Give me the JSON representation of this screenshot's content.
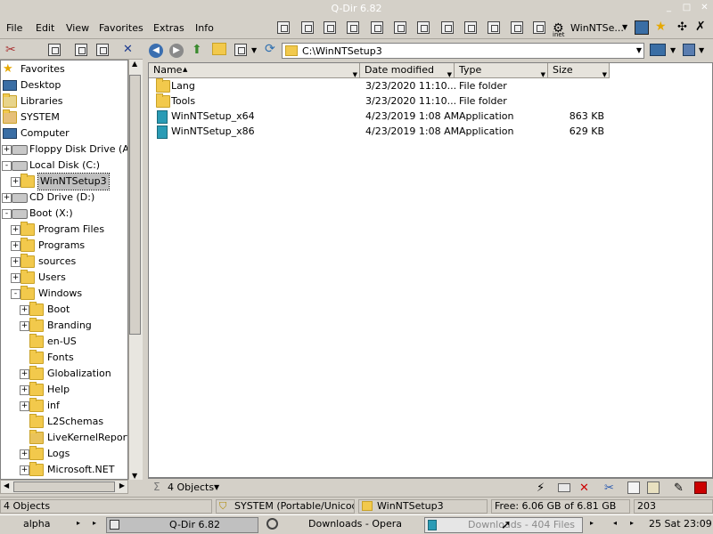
{
  "window": {
    "title": "Q-Dir 6.82"
  },
  "menu": [
    "File",
    "Edit",
    "View",
    "Favorites",
    "Extras",
    "Info"
  ],
  "toolbar": {
    "brand_label": "WinNTSe...",
    "inet_label": "inet"
  },
  "tree": {
    "items": [
      {
        "label": "Favorites",
        "icon": "star-icon",
        "level": 0,
        "expander": ""
      },
      {
        "label": "Desktop",
        "icon": "desktop-icon",
        "level": 0,
        "expander": ""
      },
      {
        "label": "Libraries",
        "icon": "libraries-icon",
        "level": 0,
        "expander": ""
      },
      {
        "label": "SYSTEM",
        "icon": "user-folder-icon",
        "level": 0,
        "expander": ""
      },
      {
        "label": "Computer",
        "icon": "computer-icon",
        "level": 0,
        "expander": ""
      },
      {
        "label": "Floppy Disk Drive (A:)",
        "icon": "floppy-drive-icon",
        "level": 1,
        "expander": "+"
      },
      {
        "label": "Local Disk (C:)",
        "icon": "disk-drive-icon",
        "level": 1,
        "expander": "-"
      },
      {
        "label": "WinNTSetup3",
        "icon": "folder-icon",
        "level": 2,
        "expander": "+",
        "selected": true
      },
      {
        "label": "CD Drive (D:)",
        "icon": "cd-drive-icon",
        "level": 1,
        "expander": "+"
      },
      {
        "label": "Boot (X:)",
        "icon": "disk-drive-icon",
        "level": 1,
        "expander": "-"
      },
      {
        "label": "Program Files",
        "icon": "folder-icon",
        "level": 2,
        "expander": "+"
      },
      {
        "label": "Programs",
        "icon": "folder-icon",
        "level": 2,
        "expander": "+"
      },
      {
        "label": "sources",
        "icon": "folder-icon",
        "level": 2,
        "expander": "+"
      },
      {
        "label": "Users",
        "icon": "folder-icon",
        "level": 2,
        "expander": "+"
      },
      {
        "label": "Windows",
        "icon": "folder-icon",
        "level": 2,
        "expander": "-"
      },
      {
        "label": "Boot",
        "icon": "folder-icon",
        "level": 3,
        "expander": "+"
      },
      {
        "label": "Branding",
        "icon": "folder-icon",
        "level": 3,
        "expander": "+"
      },
      {
        "label": "en-US",
        "icon": "folder-icon",
        "level": 3,
        "expander": ""
      },
      {
        "label": "Fonts",
        "icon": "folder-icon",
        "level": 3,
        "expander": ""
      },
      {
        "label": "Globalization",
        "icon": "folder-icon",
        "level": 3,
        "expander": "+"
      },
      {
        "label": "Help",
        "icon": "folder-icon",
        "level": 3,
        "expander": "+"
      },
      {
        "label": "inf",
        "icon": "folder-icon",
        "level": 3,
        "expander": "+"
      },
      {
        "label": "L2Schemas",
        "icon": "folder-icon",
        "level": 3,
        "expander": ""
      },
      {
        "label": "LiveKernelReports",
        "icon": "locked-folder-icon",
        "level": 3,
        "expander": ""
      },
      {
        "label": "Logs",
        "icon": "folder-icon",
        "level": 3,
        "expander": "+"
      },
      {
        "label": "Microsoft.NET",
        "icon": "folder-icon",
        "level": 3,
        "expander": "+"
      }
    ]
  },
  "address": {
    "path": "C:\\WinNTSetup3"
  },
  "columns": [
    {
      "label": "Name"
    },
    {
      "label": "Date modified"
    },
    {
      "label": "Type"
    },
    {
      "label": "Size"
    }
  ],
  "files": [
    {
      "name": "Lang",
      "date": "3/23/2020 11:10...",
      "type": "File folder",
      "size": "",
      "icon": "folder-icon"
    },
    {
      "name": "Tools",
      "date": "3/23/2020 11:10...",
      "type": "File folder",
      "size": "",
      "icon": "folder-icon"
    },
    {
      "name": "WinNTSetup_x64",
      "date": "4/23/2019 1:08 AM",
      "type": "Application",
      "size": "863 KB",
      "icon": "application-icon"
    },
    {
      "name": "WinNTSetup_x86",
      "date": "4/23/2019 1:08 AM",
      "type": "Application",
      "size": "629 KB",
      "icon": "application-icon"
    }
  ],
  "pane_footer": {
    "objects": "4 Objects"
  },
  "status": {
    "objects": "4 Objects",
    "system": "SYSTEM (Portable/Unicode)",
    "folder": "WinNTSetup3",
    "free": "Free: 6.06 GB of 6.81 GB",
    "number": "203"
  },
  "taskbar": {
    "start": "alpha",
    "tasks": [
      "Q-Dir 6.82",
      "Downloads - Opera",
      "Downloads - 404 Files"
    ],
    "clock": "25 Sat 23:09"
  },
  "colors": {
    "accent": "#3b6fb0",
    "folder": "#f2c94c",
    "window_bg": "#d4d0c8"
  }
}
